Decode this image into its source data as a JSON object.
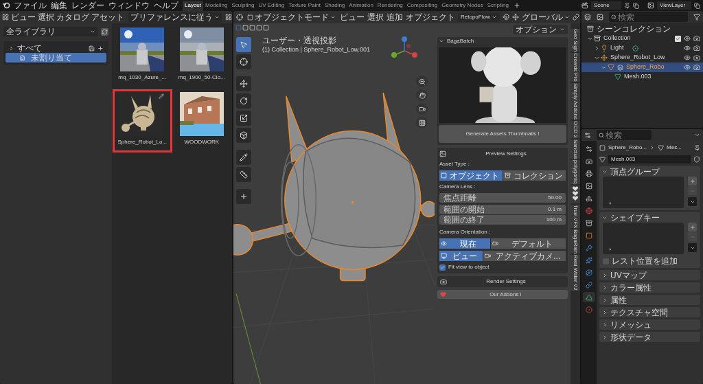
{
  "topbar": {
    "menus": [
      "ファイル",
      "編集",
      "レンダー",
      "ウィンドウ",
      "ヘルプ"
    ],
    "workspaces": [
      {
        "label": "Layout",
        "selected": true
      },
      {
        "label": "Modeling",
        "selected": false
      },
      {
        "label": "Sculpting",
        "selected": false
      },
      {
        "label": "UV Editing",
        "selected": false
      },
      {
        "label": "Texture Paint",
        "selected": false
      },
      {
        "label": "Shading",
        "selected": false
      },
      {
        "label": "Animation",
        "selected": false
      },
      {
        "label": "Rendering",
        "selected": false
      },
      {
        "label": "Compositing",
        "selected": false
      },
      {
        "label": "Geometry Nodes",
        "selected": false
      },
      {
        "label": "Scripting",
        "selected": false
      }
    ],
    "scene": "Scene",
    "view_layer": "ViewLayer"
  },
  "asset_browser": {
    "menus": [
      "ビュー",
      "選択",
      "カタログ",
      "アセット"
    ],
    "import_method": "プリファレンスに従う",
    "library": "全ライブラリ",
    "catalogs": [
      {
        "label": "すべて",
        "expanded": false,
        "selected": false,
        "children": [
          {
            "label": "未割り当て",
            "selected": true
          }
        ]
      }
    ],
    "assets": [
      {
        "name": "mq_1030_Azure_...",
        "kind": "sky",
        "highlighted": false
      },
      {
        "name": "mq_1900_50-Clo...",
        "kind": "cloudy",
        "highlighted": false
      },
      {
        "name": "Sphere_Robot_Lo...",
        "kind": "robot",
        "highlighted": true
      },
      {
        "name": "WOODWORK",
        "kind": "building",
        "highlighted": false
      }
    ]
  },
  "viewport": {
    "menus": [
      "ビュー",
      "選択",
      "追加",
      "オブジェクト"
    ],
    "mode": "オブジェクトモード",
    "addon": "RetopoFlow",
    "orientation": "グローバル",
    "options": "オプション",
    "view_name": "ユーザー・透視投影",
    "view_info": "(1) Collection | Sphere_Robot_Low.001",
    "tabs": [
      {
        "label": "Geo Sign",
        "kind": "text"
      },
      {
        "label": "Crowds Pro",
        "kind": "text"
      },
      {
        "label": "Simply Addons",
        "kind": "text"
      },
      {
        "label": "OCD 2",
        "kind": "text"
      },
      {
        "label": "Sanctus",
        "kind": "text"
      },
      {
        "label": "polygoniq",
        "kind": "text"
      },
      {
        "kind": "hearts"
      },
      {
        "label": "True-VFX",
        "kind": "text"
      },
      {
        "label": "BagaRain",
        "kind": "text"
      },
      {
        "label": "Real Water V2",
        "kind": "text"
      }
    ]
  },
  "bagabatch": {
    "title": "BagaBatch",
    "generate": "Generate Assets Thumbnails !",
    "preview_settings": "Preview Settings",
    "asset_type_label": "Asset Type :",
    "asset_types": [
      {
        "label": "オブジェクト",
        "kind": "object",
        "selected": true
      },
      {
        "label": "コレクション",
        "kind": "collection",
        "selected": false
      }
    ],
    "camera_lens_label": "Camera Lens :",
    "lens_fields": [
      {
        "label": "焦点距離",
        "value": "50.00"
      }
    ],
    "clip_fields": [
      {
        "label": "範囲の開始",
        "value": "0.1 m"
      },
      {
        "label": "範囲の終了",
        "value": "100 m"
      }
    ],
    "orientation_label": "Camera Orientation :",
    "orientation_rows": [
      [
        {
          "label": "現在",
          "kind": "eye",
          "selected": true
        },
        {
          "label": "デフォルト",
          "kind": "camera",
          "selected": false
        }
      ],
      [
        {
          "label": "ビュー",
          "kind": "view",
          "selected": true
        },
        {
          "label": "アクティブカメ...",
          "kind": "camera",
          "selected": false
        }
      ]
    ],
    "fit_view": {
      "label": "Fit view to object",
      "checked": true
    },
    "render_settings": "Render Settings",
    "our_addons": "Our Addons !"
  },
  "outliner": {
    "search_placeholder": "検索",
    "root": "シーンコレクション",
    "tree": [
      {
        "label": "Collection",
        "kind": "collection",
        "expanded": true,
        "selected": false,
        "checked": true,
        "children": [
          {
            "label": "Light",
            "kind": "light",
            "expanded": false,
            "selected": false
          },
          {
            "label": "Sphere_Robot_Low",
            "kind": "empty",
            "expanded": true,
            "selected": false,
            "children": [
              {
                "label": "Sphere_Robo",
                "kind": "mesh_object",
                "expanded": true,
                "selected": true,
                "children": [
                  {
                    "label": "Mesh.003",
                    "kind": "mesh_data",
                    "selected": false
                  }
                ]
              }
            ]
          }
        ]
      }
    ]
  },
  "properties": {
    "search_placeholder": "検索",
    "tabs": [
      {
        "kind": "tool",
        "selected": false
      },
      {
        "kind": "render",
        "selected": false
      },
      {
        "kind": "output",
        "selected": false
      },
      {
        "kind": "view_layer",
        "selected": false
      },
      {
        "kind": "scene",
        "selected": false
      },
      {
        "kind": "world",
        "selected": false
      },
      {
        "kind": "collection",
        "selected": false
      },
      {
        "kind": "object",
        "selected": false
      },
      {
        "kind": "modifier",
        "selected": false
      },
      {
        "kind": "particles",
        "selected": false
      },
      {
        "kind": "physics",
        "selected": false
      },
      {
        "kind": "constraints",
        "selected": false
      },
      {
        "kind": "data",
        "selected": true
      },
      {
        "kind": "material",
        "selected": false
      }
    ],
    "breadcrumb": [
      "Sphere_Robo...",
      "Mes..."
    ],
    "mesh_name": "Mesh.003",
    "panels": [
      {
        "label": "頂点グループ",
        "expanded": true
      },
      {
        "label": "シェイプキー",
        "expanded": true,
        "option": {
          "label": "レスト位置を追加",
          "checked": false
        }
      },
      {
        "label": "UVマップ",
        "expanded": false
      },
      {
        "label": "カラー属性",
        "expanded": false
      },
      {
        "label": "属性",
        "expanded": false
      },
      {
        "label": "テクスチャ空間",
        "expanded": false
      },
      {
        "label": "リメッシュ",
        "expanded": false
      },
      {
        "label": "形状データ",
        "expanded": false
      }
    ]
  }
}
